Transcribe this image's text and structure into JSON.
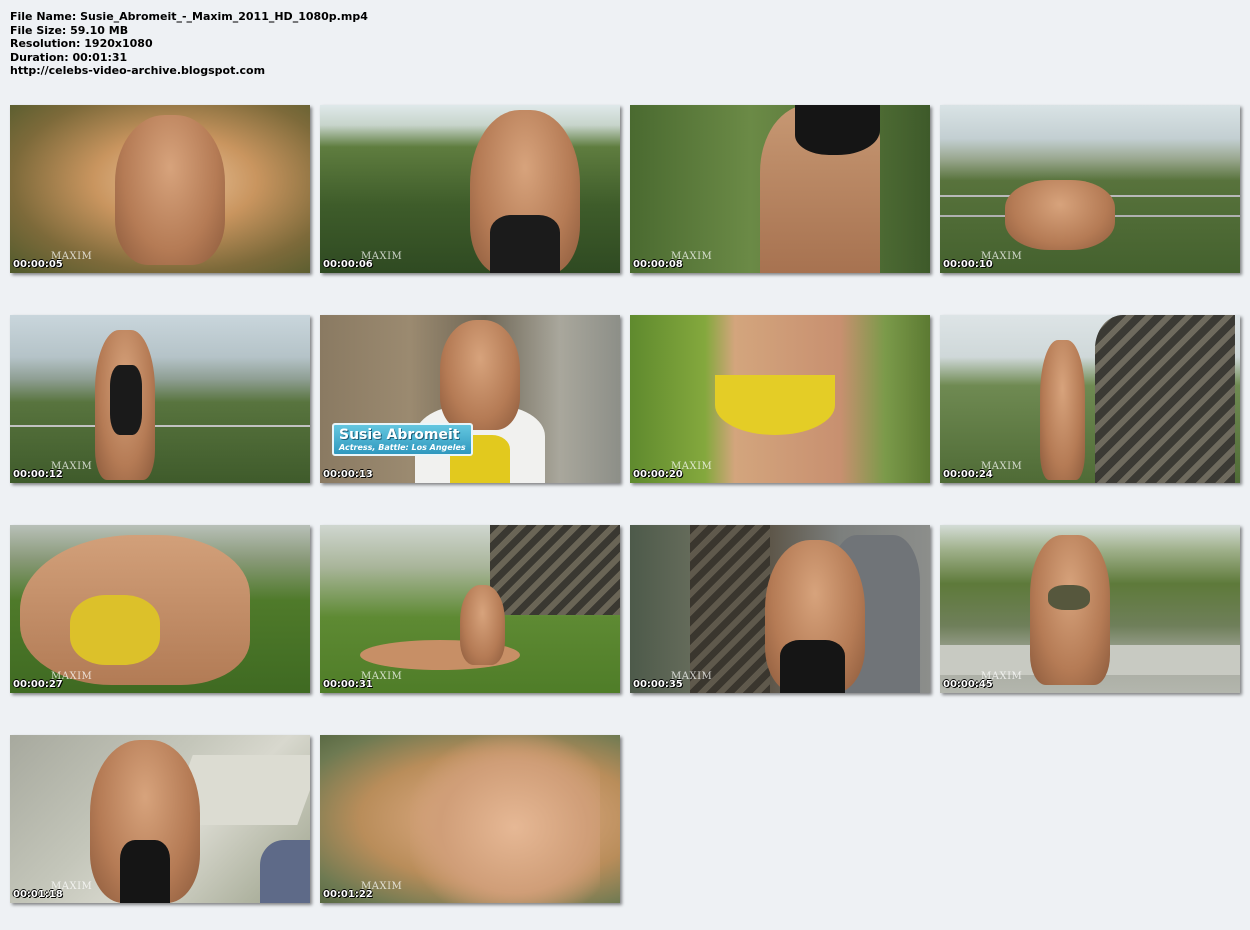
{
  "info": {
    "file_name": "File Name: Susie_Abromeit_-_Maxim_2011_HD_1080p.mp4",
    "file_size": "File Size: 59.10 MB",
    "resolution": "Resolution: 1920x1080",
    "duration": "Duration: 00:01:31",
    "url": "http://celebs-video-archive.blogspot.com"
  },
  "brand": "MAXIM",
  "caption": {
    "name": "Susie Abromeit",
    "role": "Actress, Battle: Los Angeles"
  },
  "thumbnails": [
    {
      "time": "00:00:05"
    },
    {
      "time": "00:00:06"
    },
    {
      "time": "00:00:08"
    },
    {
      "time": "00:00:10"
    },
    {
      "time": "00:00:12"
    },
    {
      "time": "00:00:13"
    },
    {
      "time": "00:00:20"
    },
    {
      "time": "00:00:24"
    },
    {
      "time": "00:00:27"
    },
    {
      "time": "00:00:31"
    },
    {
      "time": "00:00:35"
    },
    {
      "time": "00:00:45"
    },
    {
      "time": "00:01:18"
    },
    {
      "time": "00:01:22"
    }
  ]
}
